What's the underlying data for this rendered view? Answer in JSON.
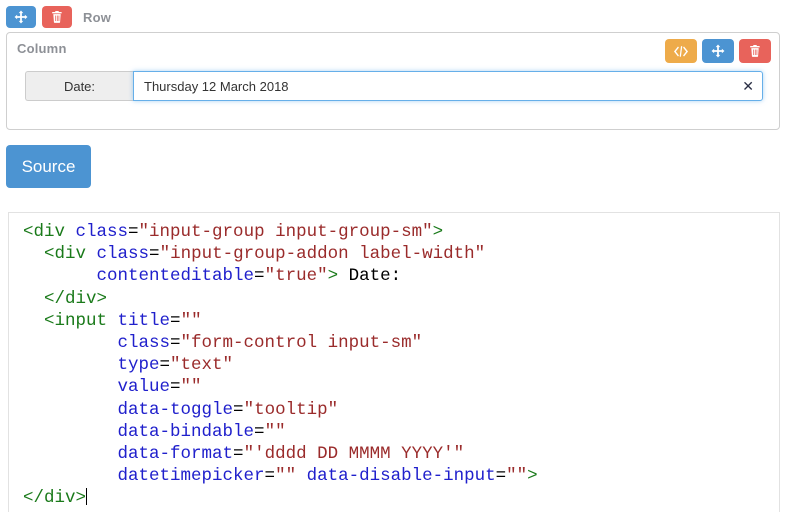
{
  "row": {
    "label": "Row",
    "move_button": "move",
    "delete_button": "delete"
  },
  "column": {
    "label": "Column",
    "code_button": "</>",
    "move_button": "move",
    "delete_button": "delete"
  },
  "form": {
    "addon_label": "Date:",
    "input_value": "Thursday 12 March 2018",
    "input_placeholder": "",
    "clear_label": "✕"
  },
  "source": {
    "button_label": "Source",
    "code_lines": [
      [
        {
          "t": "tag",
          "v": "<div "
        },
        {
          "t": "attr",
          "v": "class"
        },
        {
          "t": "punct",
          "v": "="
        },
        {
          "t": "val",
          "v": "\"input-group input-group-sm\""
        },
        {
          "t": "tag",
          "v": ">"
        }
      ],
      [
        {
          "t": "punct",
          "v": "  "
        },
        {
          "t": "tag",
          "v": "<div "
        },
        {
          "t": "attr",
          "v": "class"
        },
        {
          "t": "punct",
          "v": "="
        },
        {
          "t": "val",
          "v": "\"input-group-addon label-width\""
        }
      ],
      [
        {
          "t": "punct",
          "v": "       "
        },
        {
          "t": "attr",
          "v": "contenteditable"
        },
        {
          "t": "punct",
          "v": "="
        },
        {
          "t": "val",
          "v": "\"true\""
        },
        {
          "t": "tag",
          "v": ">"
        },
        {
          "t": "text",
          "v": " Date:"
        }
      ],
      [
        {
          "t": "punct",
          "v": "  "
        },
        {
          "t": "tag",
          "v": "</div>"
        }
      ],
      [
        {
          "t": "punct",
          "v": "  "
        },
        {
          "t": "tag",
          "v": "<input "
        },
        {
          "t": "attr",
          "v": "title"
        },
        {
          "t": "punct",
          "v": "="
        },
        {
          "t": "val",
          "v": "\"\""
        }
      ],
      [
        {
          "t": "punct",
          "v": "         "
        },
        {
          "t": "attr",
          "v": "class"
        },
        {
          "t": "punct",
          "v": "="
        },
        {
          "t": "val",
          "v": "\"form-control input-sm\""
        }
      ],
      [
        {
          "t": "punct",
          "v": "         "
        },
        {
          "t": "attr",
          "v": "type"
        },
        {
          "t": "punct",
          "v": "="
        },
        {
          "t": "val",
          "v": "\"text\""
        }
      ],
      [
        {
          "t": "punct",
          "v": "         "
        },
        {
          "t": "attr",
          "v": "value"
        },
        {
          "t": "punct",
          "v": "="
        },
        {
          "t": "val",
          "v": "\"\""
        }
      ],
      [
        {
          "t": "punct",
          "v": "         "
        },
        {
          "t": "attr",
          "v": "data-toggle"
        },
        {
          "t": "punct",
          "v": "="
        },
        {
          "t": "val",
          "v": "\"tooltip\""
        }
      ],
      [
        {
          "t": "punct",
          "v": "         "
        },
        {
          "t": "attr",
          "v": "data-bindable"
        },
        {
          "t": "punct",
          "v": "="
        },
        {
          "t": "val",
          "v": "\"\""
        }
      ],
      [
        {
          "t": "punct",
          "v": "         "
        },
        {
          "t": "attr",
          "v": "data-format"
        },
        {
          "t": "punct",
          "v": "="
        },
        {
          "t": "val",
          "v": "\"'dddd DD MMMM YYYY'\""
        }
      ],
      [
        {
          "t": "punct",
          "v": "         "
        },
        {
          "t": "attr",
          "v": "datetimepicker"
        },
        {
          "t": "punct",
          "v": "="
        },
        {
          "t": "val",
          "v": "\"\""
        },
        {
          "t": "punct",
          "v": " "
        },
        {
          "t": "attr",
          "v": "data-disable-input"
        },
        {
          "t": "punct",
          "v": "="
        },
        {
          "t": "val",
          "v": "\"\""
        },
        {
          "t": "tag",
          "v": ">"
        }
      ],
      [
        {
          "t": "tag",
          "v": "</div>"
        },
        {
          "t": "caret",
          "v": ""
        }
      ]
    ]
  },
  "colors": {
    "blue": "#4c94d2",
    "red": "#e8635b",
    "orange": "#eeab4a",
    "tag": "#1a7a1a",
    "attribute": "#2020cc",
    "value": "#9a2b2b",
    "focus_border": "#66afe9"
  }
}
